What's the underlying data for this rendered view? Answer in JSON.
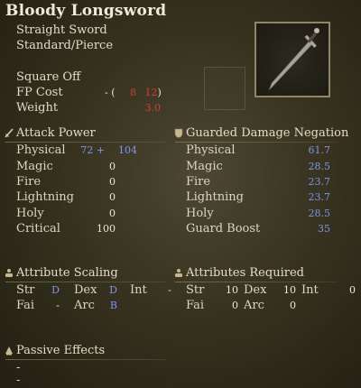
{
  "weapon": {
    "name": "Bloody Longsword",
    "type": "Straight Sword",
    "damage_type": "Standard/Pierce",
    "skill": "Square Off",
    "fp_cost_label": "FP Cost",
    "fp_cost_prefix": "- (",
    "fp_cost_1": "8",
    "fp_cost_2": "12",
    "fp_cost_suffix": ")",
    "weight_label": "Weight",
    "weight_value": "3.0"
  },
  "attack_power": {
    "title": "Attack Power",
    "rows": [
      {
        "label": "Physical",
        "base": "72 +",
        "total": "104"
      },
      {
        "label": "Magic",
        "base": "0"
      },
      {
        "label": "Fire",
        "base": "0"
      },
      {
        "label": "Lightning",
        "base": "0"
      },
      {
        "label": "Holy",
        "base": "0"
      },
      {
        "label": "Critical",
        "base": "100"
      }
    ]
  },
  "guarded": {
    "title": "Guarded Damage Negation",
    "rows": [
      {
        "label": "Physical",
        "value": "61.7"
      },
      {
        "label": "Magic",
        "value": "28.5"
      },
      {
        "label": "Fire",
        "value": "23.7"
      },
      {
        "label": "Lightning",
        "value": "23.7"
      },
      {
        "label": "Holy",
        "value": "28.5"
      },
      {
        "label": "Guard Boost",
        "value": "35"
      }
    ]
  },
  "scaling": {
    "title": "Attribute Scaling",
    "str_label": "Str",
    "str_value": "D",
    "dex_label": "Dex",
    "dex_value": "D",
    "int_label": "Int",
    "int_value": "-",
    "fai_label": "Fai",
    "fai_value": "-",
    "arc_label": "Arc",
    "arc_value": "B"
  },
  "required": {
    "title": "Attributes Required",
    "str_label": "Str",
    "str_value": "10",
    "dex_label": "Dex",
    "dex_value": "10",
    "int_label": "Int",
    "int_value": "0",
    "fai_label": "Fai",
    "fai_value": "0",
    "arc_label": "Arc",
    "arc_value": "0"
  },
  "passive": {
    "title": "Passive Effects",
    "line1": "-",
    "line2": "-"
  },
  "icons": {
    "attack_power": "sword-icon",
    "guarded": "shield-icon",
    "scaling": "scaling-icon",
    "required": "requirement-icon",
    "passive": "passive-icon",
    "weapon": "longsword-icon"
  },
  "colors": {
    "red_value": "#d83c31",
    "blue_value": "#7f93ea",
    "frame_border": "#8e8667"
  }
}
